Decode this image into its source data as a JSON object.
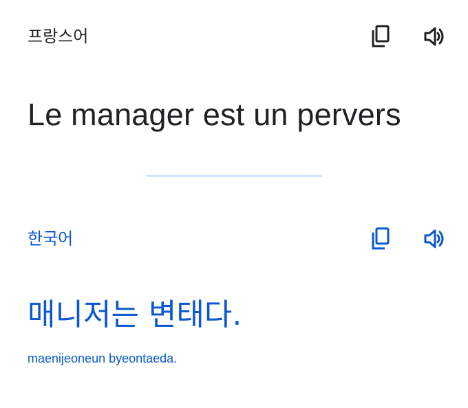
{
  "source": {
    "language": "프랑스어",
    "text": "Le manager est un pervers",
    "copy_icon": "copy-icon",
    "speak_icon": "speaker-icon"
  },
  "target": {
    "language": "한국어",
    "text": "매니저는 변태다.",
    "romanization": "maenijeoneun byeontaeda.",
    "copy_icon": "copy-icon",
    "speak_icon": "speaker-icon"
  },
  "colors": {
    "source_text": "#202124",
    "accent": "#0b57d0",
    "divider": "#d3e3fd"
  }
}
